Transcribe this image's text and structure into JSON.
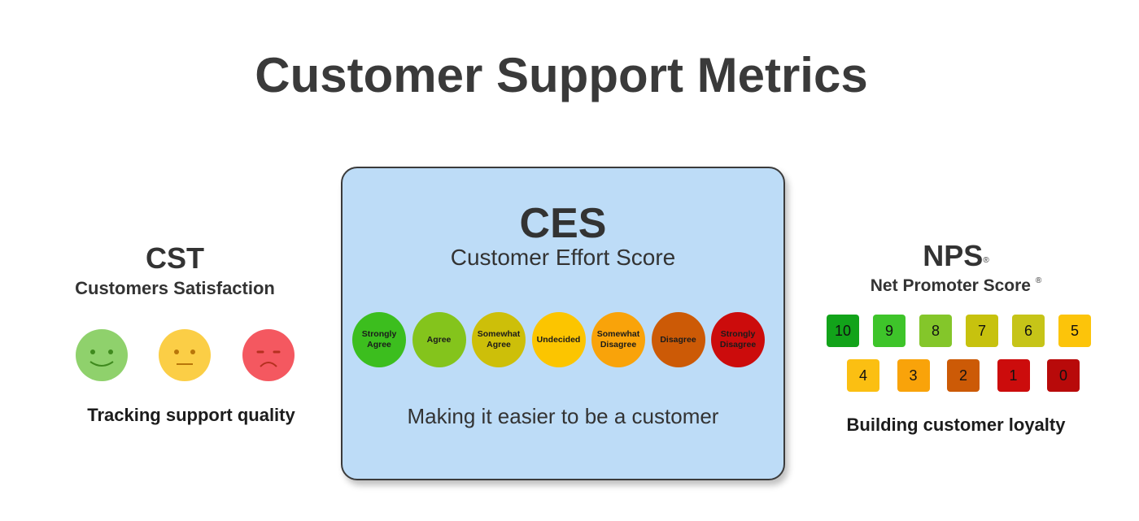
{
  "title": "Customer Support Metrics",
  "cst": {
    "abbr": "CST",
    "full": "Customers Satisfaction",
    "tagline": "Tracking support quality",
    "faces": [
      {
        "mood": "happy",
        "color": "#8fd16c",
        "feature_color": "#3f8a1e"
      },
      {
        "mood": "neutral",
        "color": "#fbce46",
        "feature_color": "#b8760a"
      },
      {
        "mood": "sad",
        "color": "#f45860",
        "feature_color": "#b5301f"
      }
    ]
  },
  "ces": {
    "abbr": "CES",
    "full": "Customer Effort Score",
    "tagline": "Making it easier to be a customer",
    "card_color": "#bddcf7",
    "options": [
      {
        "label": "Strongly Agree",
        "color": "#3cbe1e"
      },
      {
        "label": "Agree",
        "color": "#84c41c"
      },
      {
        "label": "Somewhat Agree",
        "color": "#cdbf09"
      },
      {
        "label": "Undecided",
        "color": "#fcc500"
      },
      {
        "label": "Somewhat Disagree",
        "color": "#f9a30a"
      },
      {
        "label": "Disagree",
        "color": "#cc5a06"
      },
      {
        "label": "Strongly Disagree",
        "color": "#cc0c0c"
      }
    ]
  },
  "nps": {
    "abbr": "NPS",
    "full": "Net Promoter Score",
    "registered_mark": "®",
    "tagline": "Building customer loyalty",
    "scores": [
      {
        "value": "10",
        "color": "#12a31a"
      },
      {
        "value": "9",
        "color": "#3ec42a"
      },
      {
        "value": "8",
        "color": "#84c62a"
      },
      {
        "value": "7",
        "color": "#c7c20e"
      },
      {
        "value": "6",
        "color": "#c6c418"
      },
      {
        "value": "5",
        "color": "#fcc40a"
      },
      {
        "value": "4",
        "color": "#fbbf12"
      },
      {
        "value": "3",
        "color": "#f9a30a"
      },
      {
        "value": "2",
        "color": "#cc5a06"
      },
      {
        "value": "1",
        "color": "#cc0c0c"
      },
      {
        "value": "0",
        "color": "#b80a0a"
      }
    ]
  }
}
